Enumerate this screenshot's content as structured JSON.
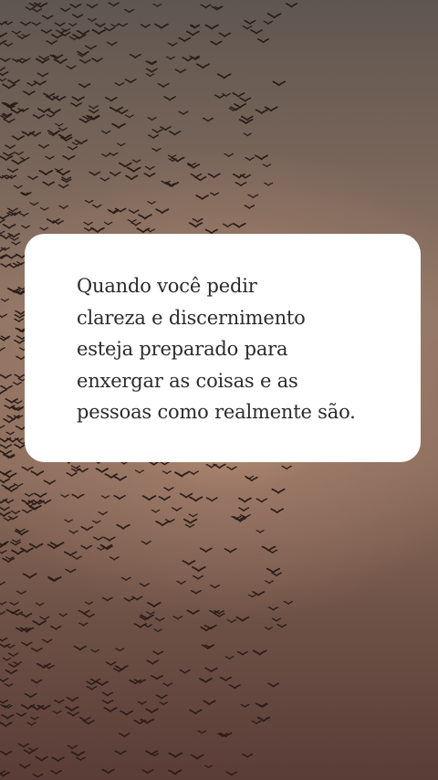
{
  "background": {
    "description_colors": [
      "#5f5650",
      "#8f7564",
      "#5a3d37"
    ],
    "bird_color": "#2a1c18"
  },
  "quote": {
    "lines": [
      "Quando você pedir",
      "clareza e discernimento",
      "esteja preparado para",
      "enxergar as coisas e as",
      "pessoas como realmente são."
    ]
  }
}
